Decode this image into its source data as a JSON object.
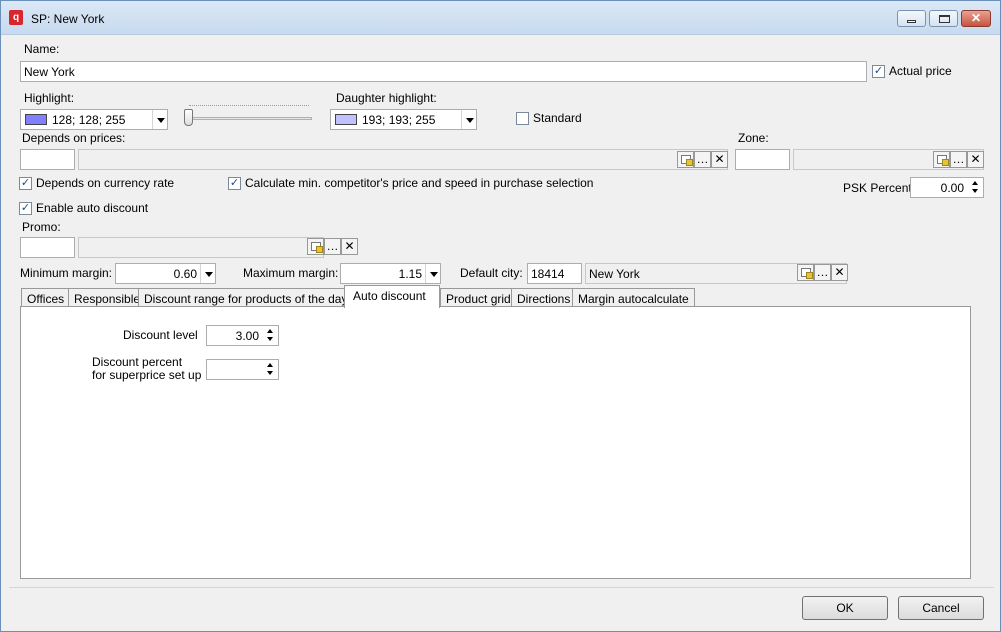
{
  "window": {
    "title": "SP: New York"
  },
  "form": {
    "name_label": "Name:",
    "name_value": "New York",
    "actual_price_label": "Actual price",
    "actual_price_checked": true,
    "highlight_label": "Highlight:",
    "highlight_value": "128; 128; 255",
    "highlight_color": "#8080ff",
    "daughter_highlight_label": "Daughter highlight:",
    "daughter_highlight_value": "193; 193; 255",
    "daughter_highlight_color": "#c1c1ff",
    "standard_label": "Standard",
    "standard_checked": false,
    "depends_on_prices_label": "Depends on prices:",
    "zone_label": "Zone:",
    "depends_currency_label": "Depends on currency rate",
    "depends_currency_checked": true,
    "calc_min_label": "Calculate min. competitor's price and speed in purchase selection",
    "calc_min_checked": true,
    "psk_percent_label": "PSK Percent:",
    "psk_percent_value": "0.00",
    "enable_auto_discount_label": "Enable auto discount",
    "enable_auto_discount_checked": true,
    "promo_label": "Promo:",
    "min_margin_label": "Minimum margin:",
    "min_margin_value": "0.60",
    "max_margin_label": "Maximum margin:",
    "max_margin_value": "1.15",
    "default_city_label": "Default city:",
    "default_city_code": "18414",
    "default_city_name": "New York"
  },
  "tabs": [
    {
      "label": "Offices"
    },
    {
      "label": "Responsible"
    },
    {
      "label": "Discount range for products of the day"
    },
    {
      "label": "Auto discount"
    },
    {
      "label": "Product grid"
    },
    {
      "label": "Directions"
    },
    {
      "label": "Margin autocalculate"
    }
  ],
  "active_tab": "Auto discount",
  "auto_discount": {
    "discount_level_label": "Discount level",
    "discount_level_value": "3.00",
    "discount_percent_label_line1": "Discount percent",
    "discount_percent_label_line2": "for superprice set up",
    "discount_percent_value": ""
  },
  "buttons": {
    "ok": "OK",
    "cancel": "Cancel"
  },
  "icons": {
    "ellipsis": "…",
    "clear": "✕",
    "check": "✓"
  }
}
